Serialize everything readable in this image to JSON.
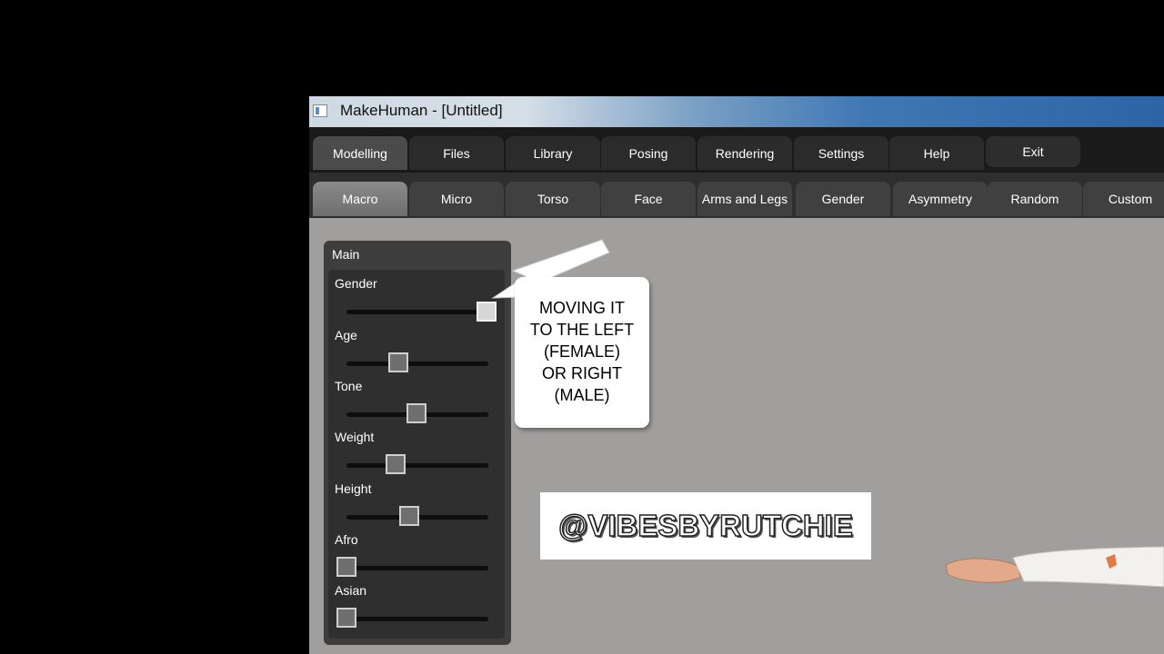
{
  "window": {
    "title": "MakeHuman - [Untitled]"
  },
  "main_tabs": [
    {
      "label": "Modelling",
      "active": true
    },
    {
      "label": "Files"
    },
    {
      "label": "Library"
    },
    {
      "label": "Posing"
    },
    {
      "label": "Rendering"
    },
    {
      "label": "Settings"
    },
    {
      "label": "Help"
    },
    {
      "label": "Exit"
    }
  ],
  "sub_tabs": [
    {
      "label": "Macro",
      "active": true
    },
    {
      "label": "Micro"
    },
    {
      "label": "Torso"
    },
    {
      "label": "Face"
    },
    {
      "label": "Arms and Legs"
    },
    {
      "label": "Gender"
    },
    {
      "label": "Asymmetry"
    },
    {
      "label": "Random"
    },
    {
      "label": "Custom"
    }
  ],
  "panel": {
    "title": "Main",
    "sliders": [
      {
        "label": "Gender",
        "value": 1.0
      },
      {
        "label": "Age",
        "value": 0.37
      },
      {
        "label": "Tone",
        "value": 0.5
      },
      {
        "label": "Weight",
        "value": 0.35
      },
      {
        "label": "Height",
        "value": 0.45
      },
      {
        "label": "Afro",
        "value": 0.0
      },
      {
        "label": "Asian",
        "value": 0.0
      }
    ]
  },
  "callout": {
    "lines": [
      "MOVING IT",
      "TO THE LEFT",
      "(FEMALE)",
      "OR RIGHT",
      "(MALE)"
    ]
  },
  "watermark": {
    "text": "@VIBESBYRUTCHIE"
  },
  "colors": {
    "titlebar_accent": "#2d64a6",
    "background": "#a19f9e"
  }
}
